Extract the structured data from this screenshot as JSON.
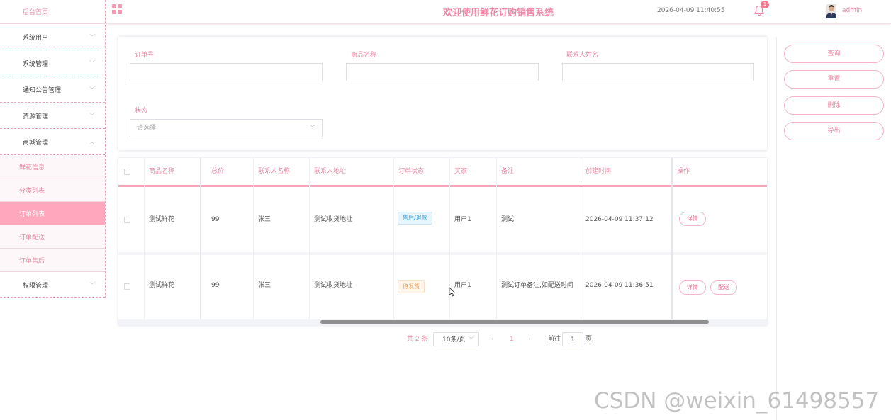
{
  "sidebar": {
    "home": "后台首页",
    "items": [
      {
        "label": "系统用户"
      },
      {
        "label": "系统管理"
      },
      {
        "label": "通知公告管理"
      },
      {
        "label": "资源管理"
      },
      {
        "label": "商城管理"
      }
    ],
    "sub_items": [
      {
        "label": "鲜花信息"
      },
      {
        "label": "分类列表"
      },
      {
        "label": "订单列表"
      },
      {
        "label": "订单配送"
      },
      {
        "label": "订单售后"
      }
    ],
    "last_item": "权限管理"
  },
  "header": {
    "title": "欢迎使用鲜花订购销售系统",
    "datetime": "2026-04-09 11:40:55",
    "notification_count": "1",
    "username": "admin"
  },
  "search": {
    "order_no_label": "订单号",
    "product_name_label": "商品名称",
    "contact_name_label": "联系人姓名",
    "status_label": "状态",
    "status_placeholder": "请选择"
  },
  "actions": {
    "query": "查询",
    "reset": "重置",
    "delete": "删除",
    "export": "导出"
  },
  "table": {
    "columns": [
      "商品名称",
      "总价",
      "联系人名称",
      "联系人地址",
      "订单状态",
      "买家",
      "备注",
      "创建时间",
      "操作"
    ],
    "rows": [
      {
        "product": "测试鲜花",
        "price": "99",
        "contact": "张三",
        "address": "测试收货地址",
        "status": "售后/退款",
        "buyer": "用户1",
        "remark": "测试",
        "created": "2026-04-09 11:37:12",
        "op1": "详情"
      },
      {
        "product": "测试鲜花",
        "price": "99",
        "contact": "张三",
        "address": "测试收货地址",
        "status": "待发货",
        "buyer": "用户1",
        "remark": "测试订单备注,如配送时间",
        "created": "2026-04-09 11:36:51",
        "op1": "详情",
        "op2": "配送"
      }
    ]
  },
  "pagination": {
    "total": "共 2 条",
    "page_size": "10条/页",
    "prev": "‹",
    "current": "1",
    "next": "›",
    "goto_label": "前往",
    "goto_value": "1",
    "page_suffix": "页"
  },
  "watermark": "CSDN @weixin_61498557",
  "colors": {
    "accent": "#f08aa8",
    "active_menu": "#ffa8bd",
    "tag_blue": "#46a4d8",
    "tag_orange": "#e7a25a"
  }
}
